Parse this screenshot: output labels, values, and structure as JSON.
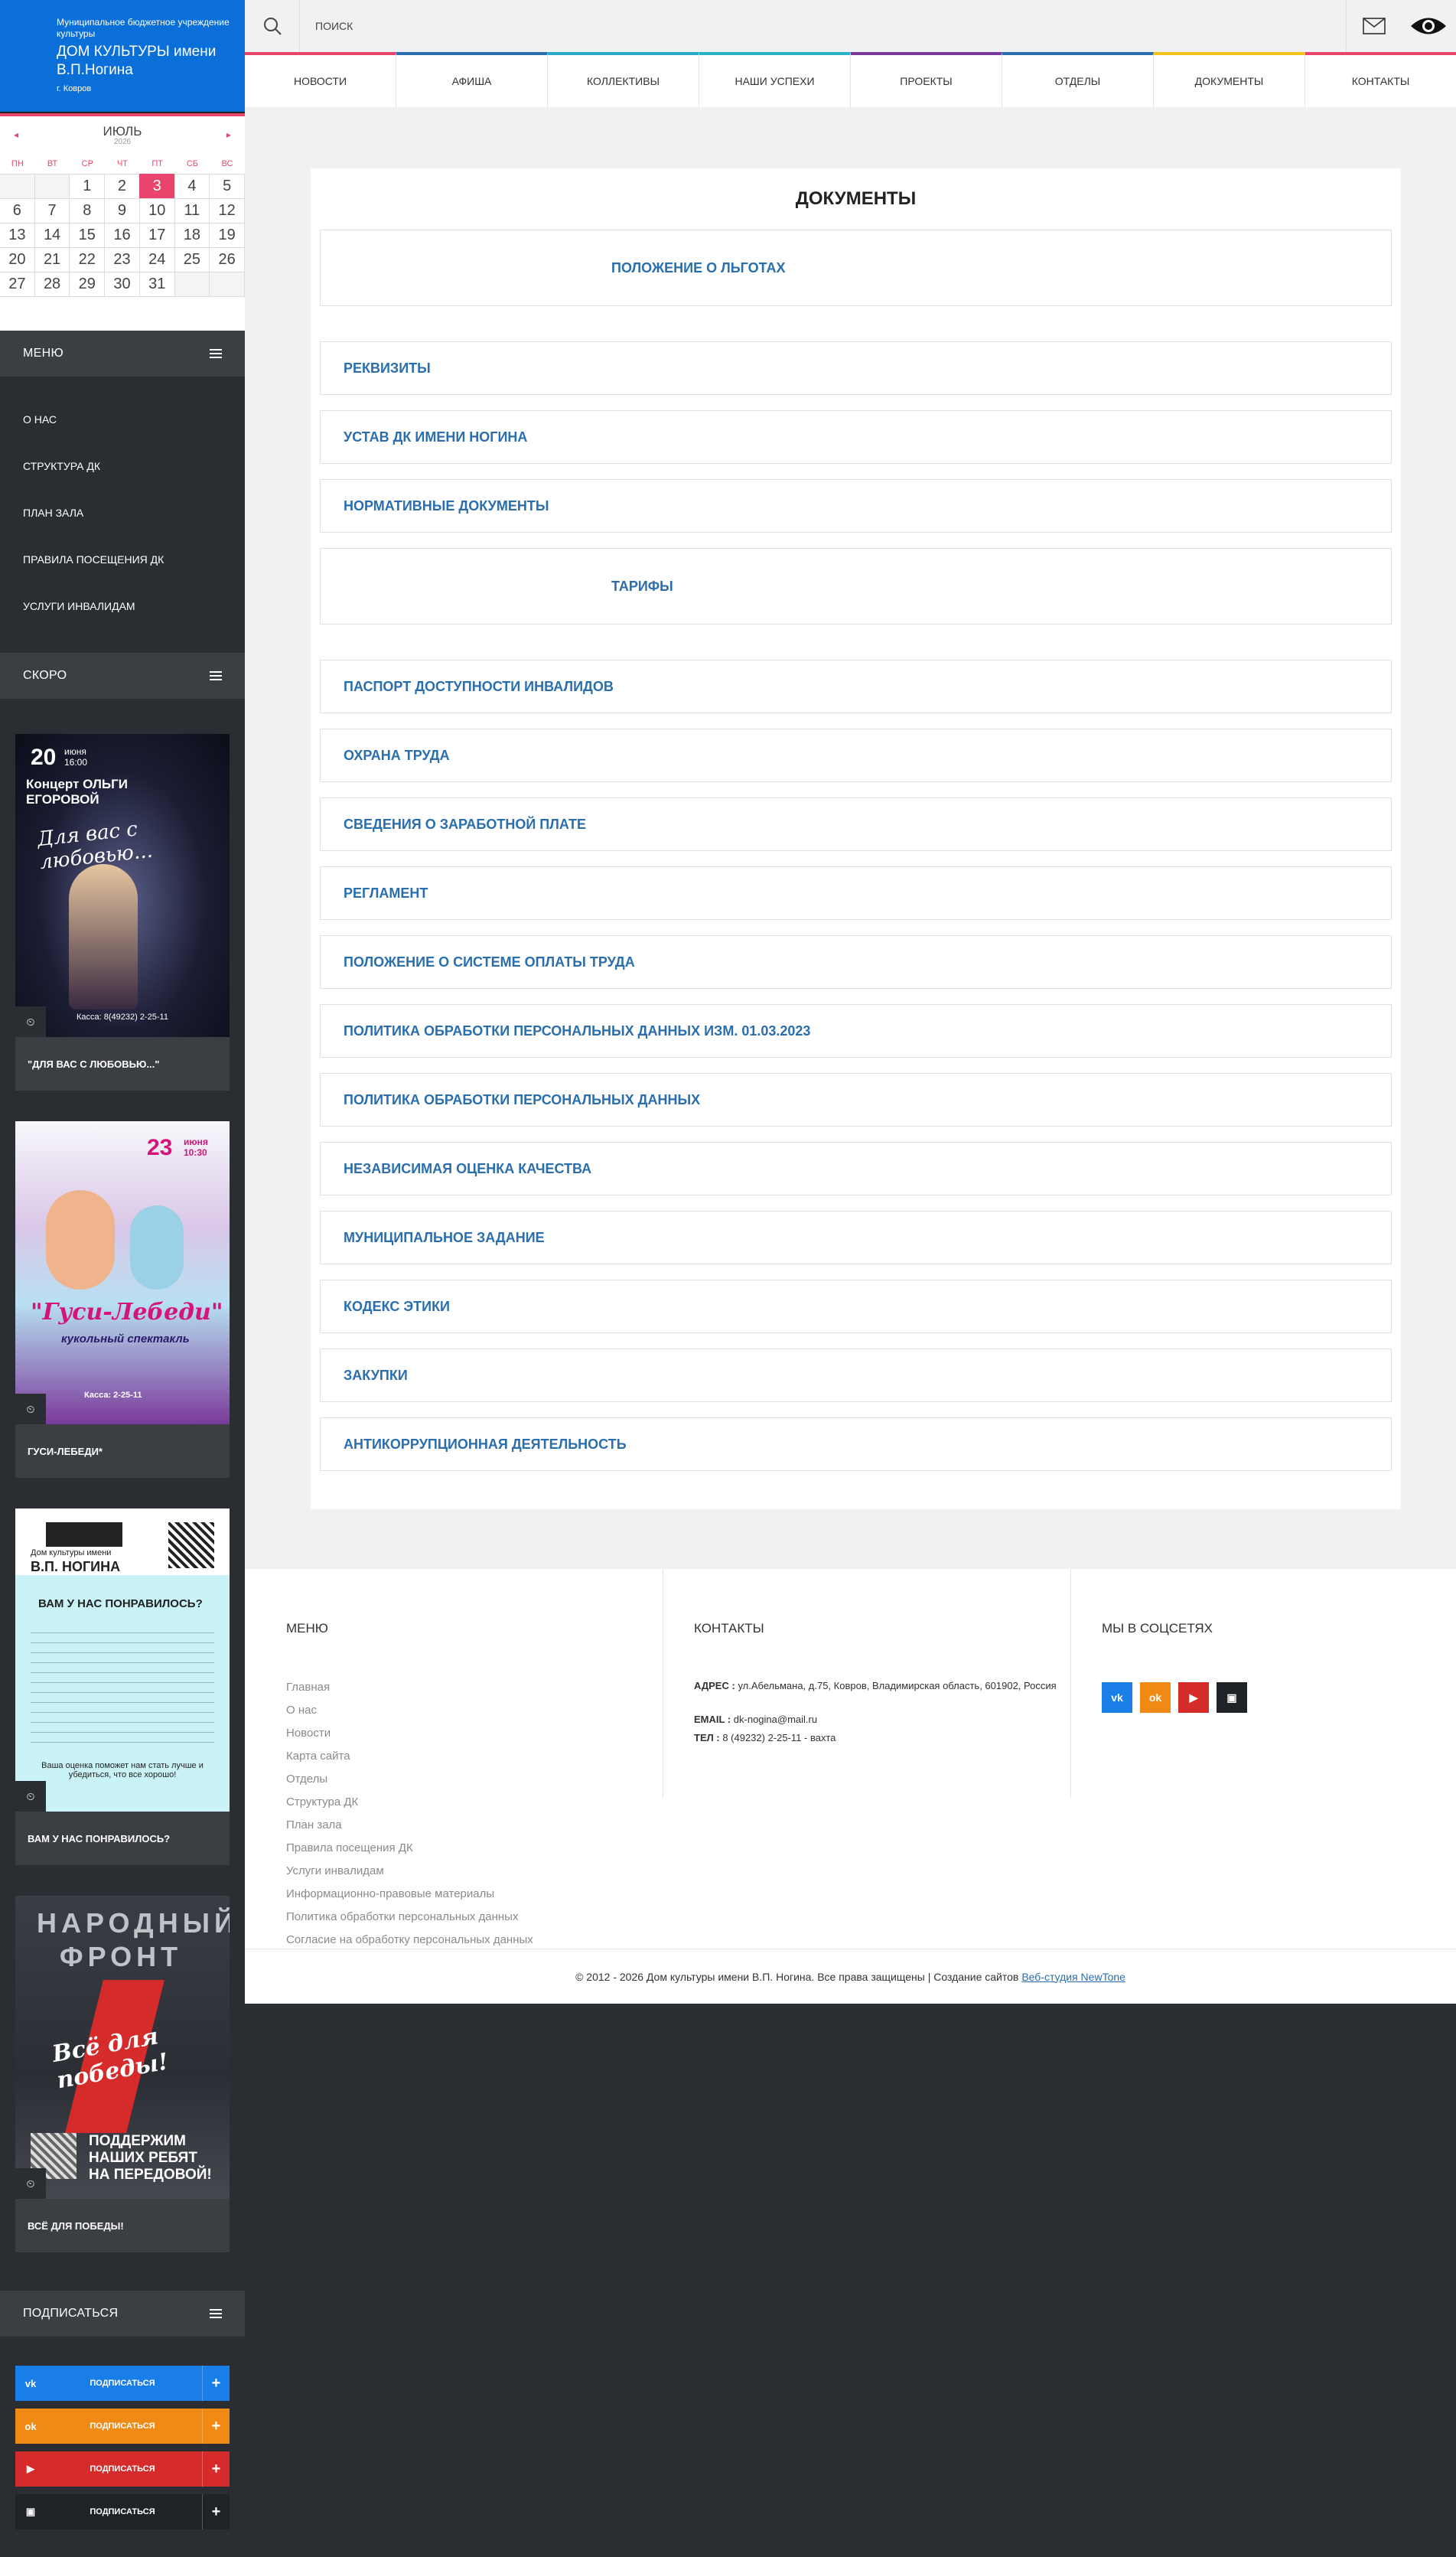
{
  "logo": {
    "line1": "Муниципальное бюджетное учреждение культуры",
    "line2": "ДОМ КУЛЬТУРЫ имени В.П.Ногина",
    "city": "г. Ковров"
  },
  "calendar": {
    "month": "ИЮЛЬ",
    "year": "2026",
    "prev": "◂",
    "next": "▸",
    "weekdays": [
      "ПН",
      "ВТ",
      "СР",
      "ЧТ",
      "ПТ",
      "СБ",
      "ВС"
    ],
    "days": [
      "",
      "",
      "1",
      "2",
      "3",
      "4",
      "5",
      "6",
      "7",
      "8",
      "9",
      "10",
      "11",
      "12",
      "13",
      "14",
      "15",
      "16",
      "17",
      "18",
      "19",
      "20",
      "21",
      "22",
      "23",
      "24",
      "25",
      "26",
      "27",
      "28",
      "29",
      "30",
      "31",
      "",
      ""
    ],
    "today": "3"
  },
  "sidebar": {
    "menu_title": "МЕНЮ",
    "menu_items": [
      "О НАС",
      "СТРУКТУРА ДК",
      "ПЛАН ЗАЛА",
      "ПРАВИЛА ПОСЕЩЕНИЯ ДК",
      "УСЛУГИ ИНВАЛИДАМ"
    ],
    "soon_title": "СКОРО",
    "posters": [
      {
        "title": "\"ДЛЯ ВАС С ЛЮБОВЬЮ...\"",
        "badge": "20",
        "badge_sub": "июня\n16:00",
        "headline": "Концерт ОЛЬГИ ЕГОРОВОЙ",
        "tagline": "Для вас с любовью...",
        "foot": "Касса: 8(49232) 2-25-11"
      },
      {
        "title": "ГУСИ-ЛЕБЕДИ*",
        "badge": "23",
        "badge_sub": "июня\n10:30",
        "headline": "\"Гуси-Лебеди\"",
        "tagline": "кукольный спектакль",
        "foot": "Касса: 2-25-11"
      },
      {
        "title": "ВАМ У НАС ПОНРАВИЛОСЬ?",
        "headline": "ВАМ У НАС ПОНРАВИЛОСЬ?",
        "brand": "В.П. НОГИНА",
        "brand_top": "Дом культуры имени",
        "tagline": "Ваша оценка поможет нам стать лучше и убедиться, что все хорошо!"
      },
      {
        "title": "ВСЁ ДЛЯ ПОБЕДЫ!",
        "headline": "НАРОДНЫЙ ФРОНТ",
        "tagline": "Всё для победы!",
        "foot": "ПОДДЕРЖИМ НАШИХ РЕБЯТ НА ПЕРЕДОВОЙ!"
      }
    ],
    "subscribe_title": "ПОДПИСАТЬСЯ",
    "subscribe_buttons": [
      {
        "label": "ПОДПИСАТЬСЯ",
        "color": "#1a7ee8",
        "icon": "vk-icon",
        "glyph": "vk"
      },
      {
        "label": "ПОДПИСАТЬСЯ",
        "color": "#f08a14",
        "icon": "odnoklassniki-icon",
        "glyph": "ok"
      },
      {
        "label": "ПОДПИСАТЬСЯ",
        "color": "#d62b2b",
        "icon": "youtube-icon",
        "glyph": "▶"
      },
      {
        "label": "ПОДПИСАТЬСЯ",
        "color": "#1f2226",
        "icon": "rutube-icon",
        "glyph": "▣"
      }
    ]
  },
  "header": {
    "search_placeholder": "ПОИСК"
  },
  "nav": [
    {
      "label": "НОВОСТИ",
      "color": "#e8446c"
    },
    {
      "label": "АФИША",
      "color": "#2a6ead"
    },
    {
      "label": "КОЛЛЕКТИВЫ",
      "color": "#2aa8c8"
    },
    {
      "label": "НАШИ УСПЕХИ",
      "color": "#28b4c4"
    },
    {
      "label": "ПРОЕКТЫ",
      "color": "#7a3a9a"
    },
    {
      "label": "ОТДЕЛЫ",
      "color": "#2a6ead"
    },
    {
      "label": "ДОКУМЕНТЫ",
      "color": "#f2c318"
    },
    {
      "label": "КОНТАКТЫ",
      "color": "#e8446c"
    }
  ],
  "docs": {
    "title": "ДОКУМЕНТЫ",
    "items": [
      "ПОЛОЖЕНИЕ О ЛЬГОТАХ",
      "РЕКВИЗИТЫ",
      "УСТАВ ДК ИМЕНИ НОГИНА",
      "НОРМАТИВНЫЕ ДОКУМЕНТЫ",
      "ТАРИФЫ",
      "ПАСПОРТ ДОСТУПНОСТИ ИНВАЛИДОВ",
      "ОХРАНА ТРУДА",
      "СВЕДЕНИЯ О ЗАРАБОТНОЙ ПЛАТЕ",
      "РЕГЛАМЕНТ",
      "ПОЛОЖЕНИЕ О СИСТЕМЕ ОПЛАТЫ ТРУДА",
      "ПОЛИТИКА ОБРАБОТКИ ПЕРСОНАЛЬНЫХ ДАННЫХ ИЗМ. 01.03.2023",
      "ПОЛИТИКА ОБРАБОТКИ ПЕРСОНАЛЬНЫХ ДАННЫХ",
      "НЕЗАВИСИМАЯ ОЦЕНКА КАЧЕСТВА",
      "МУНИЦИПАЛЬНОЕ ЗАДАНИЕ",
      "КОДЕКС ЭТИКИ",
      "ЗАКУПКИ",
      "АНТИКОРРУПЦИОННАЯ ДЕЯТЕЛЬНОСТЬ"
    ]
  },
  "footer": {
    "menu_title": "МЕНЮ",
    "menu_items": [
      "Главная",
      "О нас",
      "Новости",
      "Карта сайта",
      "Отделы",
      "Структура ДК",
      "План зала",
      "Правила посещения ДК",
      "Услуги инвалидам",
      "Информационно-правовые материалы",
      "Политика обработки персональных данных",
      "Согласие на обработку персональных данных"
    ],
    "contacts_title": "КОНТАКТЫ",
    "address_label": "АДРЕС :",
    "address": "ул.Абельмана, д.75, Ковров, Владимирская область, 601902, Россия",
    "email_label": "EMAIL :",
    "email": "dk-nogina@mail.ru",
    "phone_label": "ТЕЛ :",
    "phone": "8 (49232) 2-25-11 - вахта",
    "social_title": "МЫ В СОЦСЕТЯХ",
    "socials": [
      {
        "icon": "vk-icon",
        "glyph": "vk",
        "color": "#1a7ee8"
      },
      {
        "icon": "odnoklassniki-icon",
        "glyph": "ok",
        "color": "#f08a14"
      },
      {
        "icon": "youtube-icon",
        "glyph": "▶",
        "color": "#d62b2b"
      },
      {
        "icon": "rutube-icon",
        "glyph": "▣",
        "color": "#1f2226"
      }
    ],
    "copyright": "© 2012 - 2026 Дом культуры имени В.П. Ногина. Все права защищены | Создание сайтов",
    "copyright_link": "Веб-студия NewTone"
  }
}
